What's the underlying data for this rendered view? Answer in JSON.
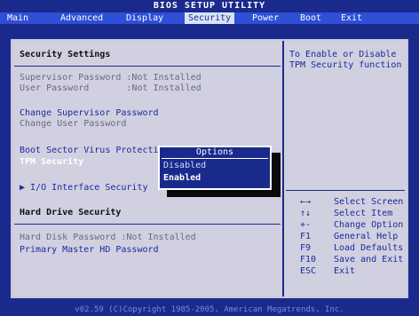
{
  "title": "BIOS SETUP UTILITY",
  "menu": [
    {
      "label": "Main"
    },
    {
      "label": "Advanced"
    },
    {
      "label": "Display"
    },
    {
      "label": "Security",
      "active": true
    },
    {
      "label": "Power"
    },
    {
      "label": "Boot"
    },
    {
      "label": "Exit"
    }
  ],
  "security_settings_header": "Security Settings",
  "supervisor_password": "Supervisor Password :Not Installed",
  "user_password": "User Password       :Not Installed",
  "change_supervisor": "Change Supervisor Password",
  "change_user": "Change User Password",
  "boot_sector": "Boot Sector Virus Protectio",
  "tpm_security": "TPM Security",
  "io_interface": "▶ I/O Interface Security",
  "hard_drive_header": "Hard Drive Security",
  "hard_disk_password": "Hard Disk Password :Not Installed",
  "primary_master": "Primary Master HD Password",
  "popup": {
    "title": "Options",
    "options": [
      "Disabled",
      "Enabled"
    ],
    "selected": "Enabled"
  },
  "help_text_line1": "To Enable or Disable",
  "help_text_line2": "TPM Security function",
  "keys": [
    {
      "key": "←→",
      "desc": "Select Screen"
    },
    {
      "key": "↑↓",
      "desc": "Select Item"
    },
    {
      "key": "+-",
      "desc": "Change Option"
    },
    {
      "key": "F1",
      "desc": "General Help"
    },
    {
      "key": "F9",
      "desc": "Load Defaults"
    },
    {
      "key": "F10",
      "desc": "Save and Exit"
    },
    {
      "key": "ESC",
      "desc": "Exit"
    }
  ],
  "footer": "v02.59 (C)Copyright 1985-2005, American Megatrends, Inc.",
  "colors": {
    "background": "#1a2a8c",
    "menubar": "#2e4fd6",
    "panel": "#d0d0e0",
    "popup": "#1a2a8c",
    "text_blue": "#1a2a9c",
    "text_grey": "#6a6a7e"
  }
}
